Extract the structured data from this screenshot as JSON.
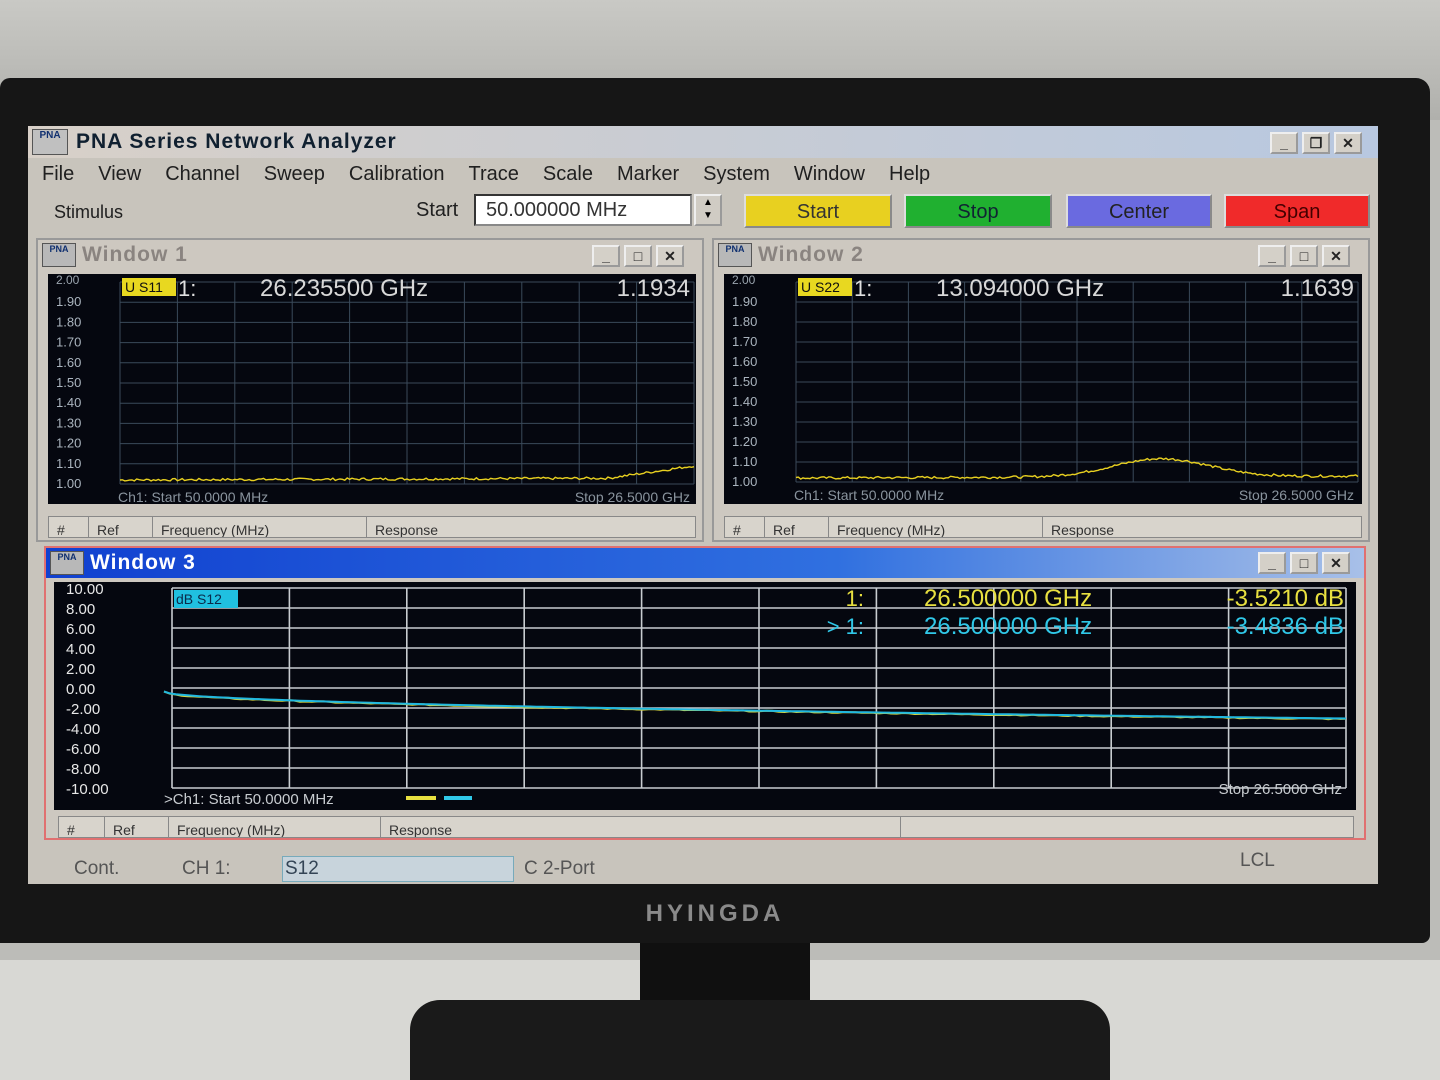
{
  "app": {
    "title": "PNA Series Network Analyzer",
    "logo_text": "PNA"
  },
  "menu": [
    "File",
    "View",
    "Channel",
    "Sweep",
    "Calibration",
    "Trace",
    "Scale",
    "Marker",
    "System",
    "Window",
    "Help"
  ],
  "stimulus": {
    "label": "Stimulus",
    "start_label": "Start",
    "start_value": "50.000000 MHz",
    "buttons": [
      {
        "label": "Start",
        "color": "#e8d020"
      },
      {
        "label": "Stop",
        "color": "#20b030"
      },
      {
        "label": "Center",
        "color": "#6a6ae0"
      },
      {
        "label": "Span",
        "color": "#f02a2a"
      }
    ]
  },
  "windows": {
    "w1": {
      "title": "Window 1",
      "trace_label": "U S11",
      "marker_index": "1:",
      "marker_freq": "26.235500 GHz",
      "marker_value": "1.1934",
      "y_ticks": [
        "1.90",
        "1.80",
        "1.70",
        "1.60",
        "1.50",
        "1.40",
        "1.30",
        "1.20",
        "1.10",
        "1.00"
      ],
      "y_top": "2.00",
      "start_text": "Ch1: Start 50.0000 MHz",
      "stop_text": "Stop 26.5000 GHz",
      "table_headers": [
        "#",
        "Ref",
        "Frequency (MHz)",
        "Response"
      ]
    },
    "w2": {
      "title": "Window 2",
      "trace_label": "U S22",
      "marker_index": "1:",
      "marker_freq": "13.094000 GHz",
      "marker_value": "1.1639",
      "y_ticks": [
        "1.90",
        "1.80",
        "1.70",
        "1.60",
        "1.50",
        "1.40",
        "1.30",
        "1.20",
        "1.10",
        "1.00"
      ],
      "y_top": "2.00",
      "start_text": "Ch1: Start 50.0000 MHz",
      "stop_text": "Stop 26.5000 GHz",
      "table_headers": [
        "#",
        "Ref",
        "Frequency (MHz)",
        "Response"
      ]
    },
    "w3": {
      "title": "Window 3",
      "trace_label": "dB S12",
      "markers": [
        {
          "index": "1:",
          "freq": "26.500000 GHz",
          "value": "-3.5210 dB",
          "color": "#e8e040"
        },
        {
          "index": "> 1:",
          "freq": "26.500000 GHz",
          "value": "-3.4836 dB",
          "color": "#30c8e8"
        }
      ],
      "y_ticks": [
        "10.00",
        "8.00",
        "6.00",
        "4.00",
        "2.00",
        "0.00",
        "-2.00",
        "-4.00",
        "-6.00",
        "-8.00",
        "-10.00"
      ],
      "start_text": ">Ch1: Start 50.0000 MHz",
      "stop_text": "Stop 26.5000 GHz",
      "table_headers": [
        "#",
        "Ref",
        "Frequency (MHz)",
        "Response"
      ]
    }
  },
  "status": {
    "mode": "Cont.",
    "channel": "CH 1:",
    "measurement": "S12",
    "cal": "C  2-Port",
    "lcl": "LCL"
  },
  "monitor_brand": "HYINGDA"
}
